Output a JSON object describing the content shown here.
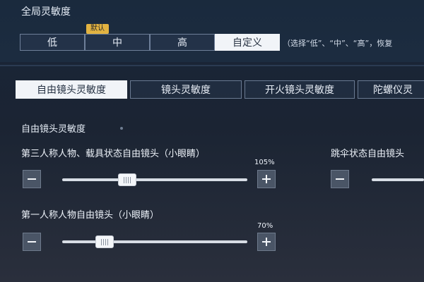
{
  "global": {
    "title": "全局灵敏度",
    "presets": [
      "低",
      "中",
      "高",
      "自定义"
    ],
    "selected_preset": "自定义",
    "default_badge": "默认",
    "hint": "（选择“低”、“中”、“高”，恢复"
  },
  "tabs": [
    {
      "label": "自由镜头灵敏度",
      "active": true
    },
    {
      "label": "镜头灵敏度",
      "active": false
    },
    {
      "label": "开火镜头灵敏度",
      "active": false
    },
    {
      "label": "陀螺仪灵",
      "active": false
    }
  ],
  "section": {
    "title": "自由镜头灵敏度",
    "sliders": [
      {
        "label": "第三人称人物、载具状态自由镜头（小眼睛）",
        "value_text": "105%",
        "level": 0.35
      },
      {
        "label": "第一人称人物自由镜头（小眼睛）",
        "value_text": "70%",
        "level": 0.23
      }
    ],
    "right_slider": {
      "label": "跳伞状态自由镜头"
    }
  },
  "icons": {
    "minus": "minus-icon",
    "plus": "plus-icon"
  }
}
